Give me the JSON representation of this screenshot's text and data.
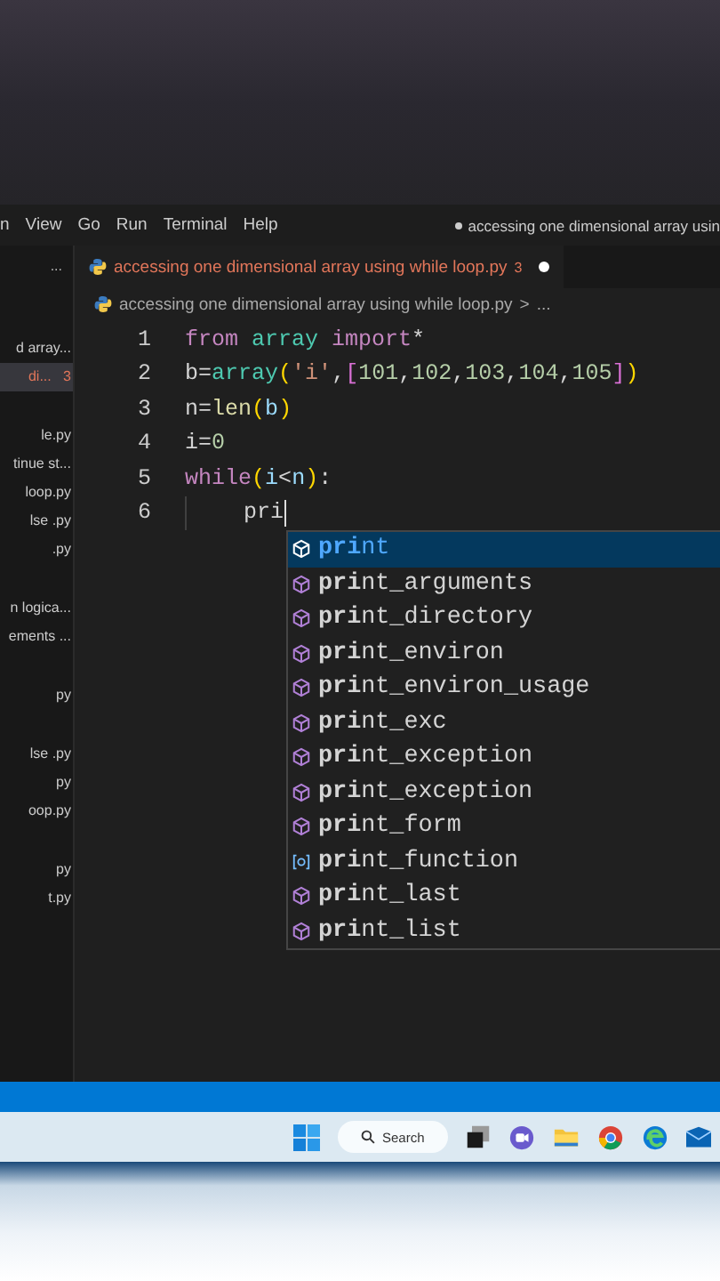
{
  "menu": [
    "n",
    "View",
    "Go",
    "Run",
    "Terminal",
    "Help"
  ],
  "title": {
    "modified": true,
    "text": "accessing one dimensional array usin"
  },
  "sidebar": {
    "more": "...",
    "items": [
      {
        "label": "d array...",
        "selected": false
      },
      {
        "label": "di...",
        "badge": "3",
        "selected": true
      },
      {
        "label": "le.py",
        "selected": false
      },
      {
        "label": "tinue st...",
        "selected": false
      },
      {
        "label": " loop.py",
        "selected": false
      },
      {
        "label": "lse .py",
        "selected": false
      },
      {
        "label": ".py",
        "selected": false
      },
      {
        "label": "n logica...",
        "selected": false
      },
      {
        "label": "ements ...",
        "selected": false
      },
      {
        "label": "py",
        "selected": false
      },
      {
        "label": "lse .py",
        "selected": false
      },
      {
        "label": "py",
        "selected": false
      },
      {
        "label": "oop.py",
        "selected": false
      },
      {
        "label": "py",
        "selected": false
      },
      {
        "label": "t.py",
        "selected": false
      }
    ]
  },
  "tab": {
    "label": "accessing one dimensional array using while loop.py",
    "problems": "3",
    "modified": true
  },
  "breadcrumb": {
    "file": "accessing one dimensional array using while loop.py",
    "separator": ">",
    "more": "..."
  },
  "code": [
    {
      "number": "1",
      "tokens": [
        {
          "kind": "keyword",
          "text": "from "
        },
        {
          "kind": "class",
          "text": "array"
        },
        {
          "kind": "keyword",
          "text": " import"
        },
        {
          "kind": "plain",
          "text": "*"
        }
      ]
    },
    {
      "number": "2",
      "tokens": [
        {
          "kind": "plain",
          "text": "b="
        },
        {
          "kind": "class",
          "text": "array"
        },
        {
          "kind": "paren",
          "text": "("
        },
        {
          "kind": "string",
          "text": "'i'"
        },
        {
          "kind": "plain",
          "text": ","
        },
        {
          "kind": "bracket",
          "text": "["
        },
        {
          "kind": "number",
          "text": "101"
        },
        {
          "kind": "plain",
          "text": ","
        },
        {
          "kind": "number",
          "text": "102"
        },
        {
          "kind": "plain",
          "text": ","
        },
        {
          "kind": "number",
          "text": "103"
        },
        {
          "kind": "plain",
          "text": ","
        },
        {
          "kind": "number",
          "text": "104"
        },
        {
          "kind": "plain",
          "text": ","
        },
        {
          "kind": "number",
          "text": "105"
        },
        {
          "kind": "bracket",
          "text": "]"
        },
        {
          "kind": "paren",
          "text": ")"
        }
      ]
    },
    {
      "number": "3",
      "tokens": [
        {
          "kind": "plain",
          "text": "n="
        },
        {
          "kind": "function",
          "text": "len"
        },
        {
          "kind": "paren",
          "text": "("
        },
        {
          "kind": "variable",
          "text": "b"
        },
        {
          "kind": "paren",
          "text": ")"
        }
      ]
    },
    {
      "number": "4",
      "tokens": [
        {
          "kind": "plain",
          "text": "i="
        },
        {
          "kind": "number",
          "text": "0"
        }
      ]
    },
    {
      "number": "5",
      "tokens": [
        {
          "kind": "keyword",
          "text": "while"
        },
        {
          "kind": "paren",
          "text": "("
        },
        {
          "kind": "variable",
          "text": "i"
        },
        {
          "kind": "plain",
          "text": "<"
        },
        {
          "kind": "variable",
          "text": "n"
        },
        {
          "kind": "paren",
          "text": ")"
        },
        {
          "kind": "plain",
          "text": ":"
        }
      ]
    },
    {
      "number": "6",
      "indent": true,
      "cursor": true,
      "tokens": [
        {
          "kind": "plain",
          "text": "pri"
        }
      ]
    }
  ],
  "suggestions": [
    {
      "kind": "method",
      "label": "**pri**nt",
      "selected": true
    },
    {
      "kind": "method",
      "label": "**pri**nt_arguments",
      "selected": false
    },
    {
      "kind": "method",
      "label": "**pri**nt_directory",
      "selected": false
    },
    {
      "kind": "method",
      "label": "**pri**nt_environ",
      "selected": false
    },
    {
      "kind": "method",
      "label": "**pri**nt_environ_usage",
      "selected": false
    },
    {
      "kind": "method",
      "label": "**pri**nt_exc",
      "selected": false
    },
    {
      "kind": "method",
      "label": "**pri**nt_exception",
      "selected": false
    },
    {
      "kind": "method",
      "label": "**pri**nt_exception",
      "selected": false
    },
    {
      "kind": "method",
      "label": "**pri**nt_form",
      "selected": false
    },
    {
      "kind": "variable",
      "label": "**pri**nt_function",
      "selected": false
    },
    {
      "kind": "method",
      "label": "**pri**nt_last",
      "selected": false
    },
    {
      "kind": "method",
      "label": "**pri**nt_list",
      "selected": false
    }
  ],
  "taskbar": {
    "search": "Search"
  }
}
